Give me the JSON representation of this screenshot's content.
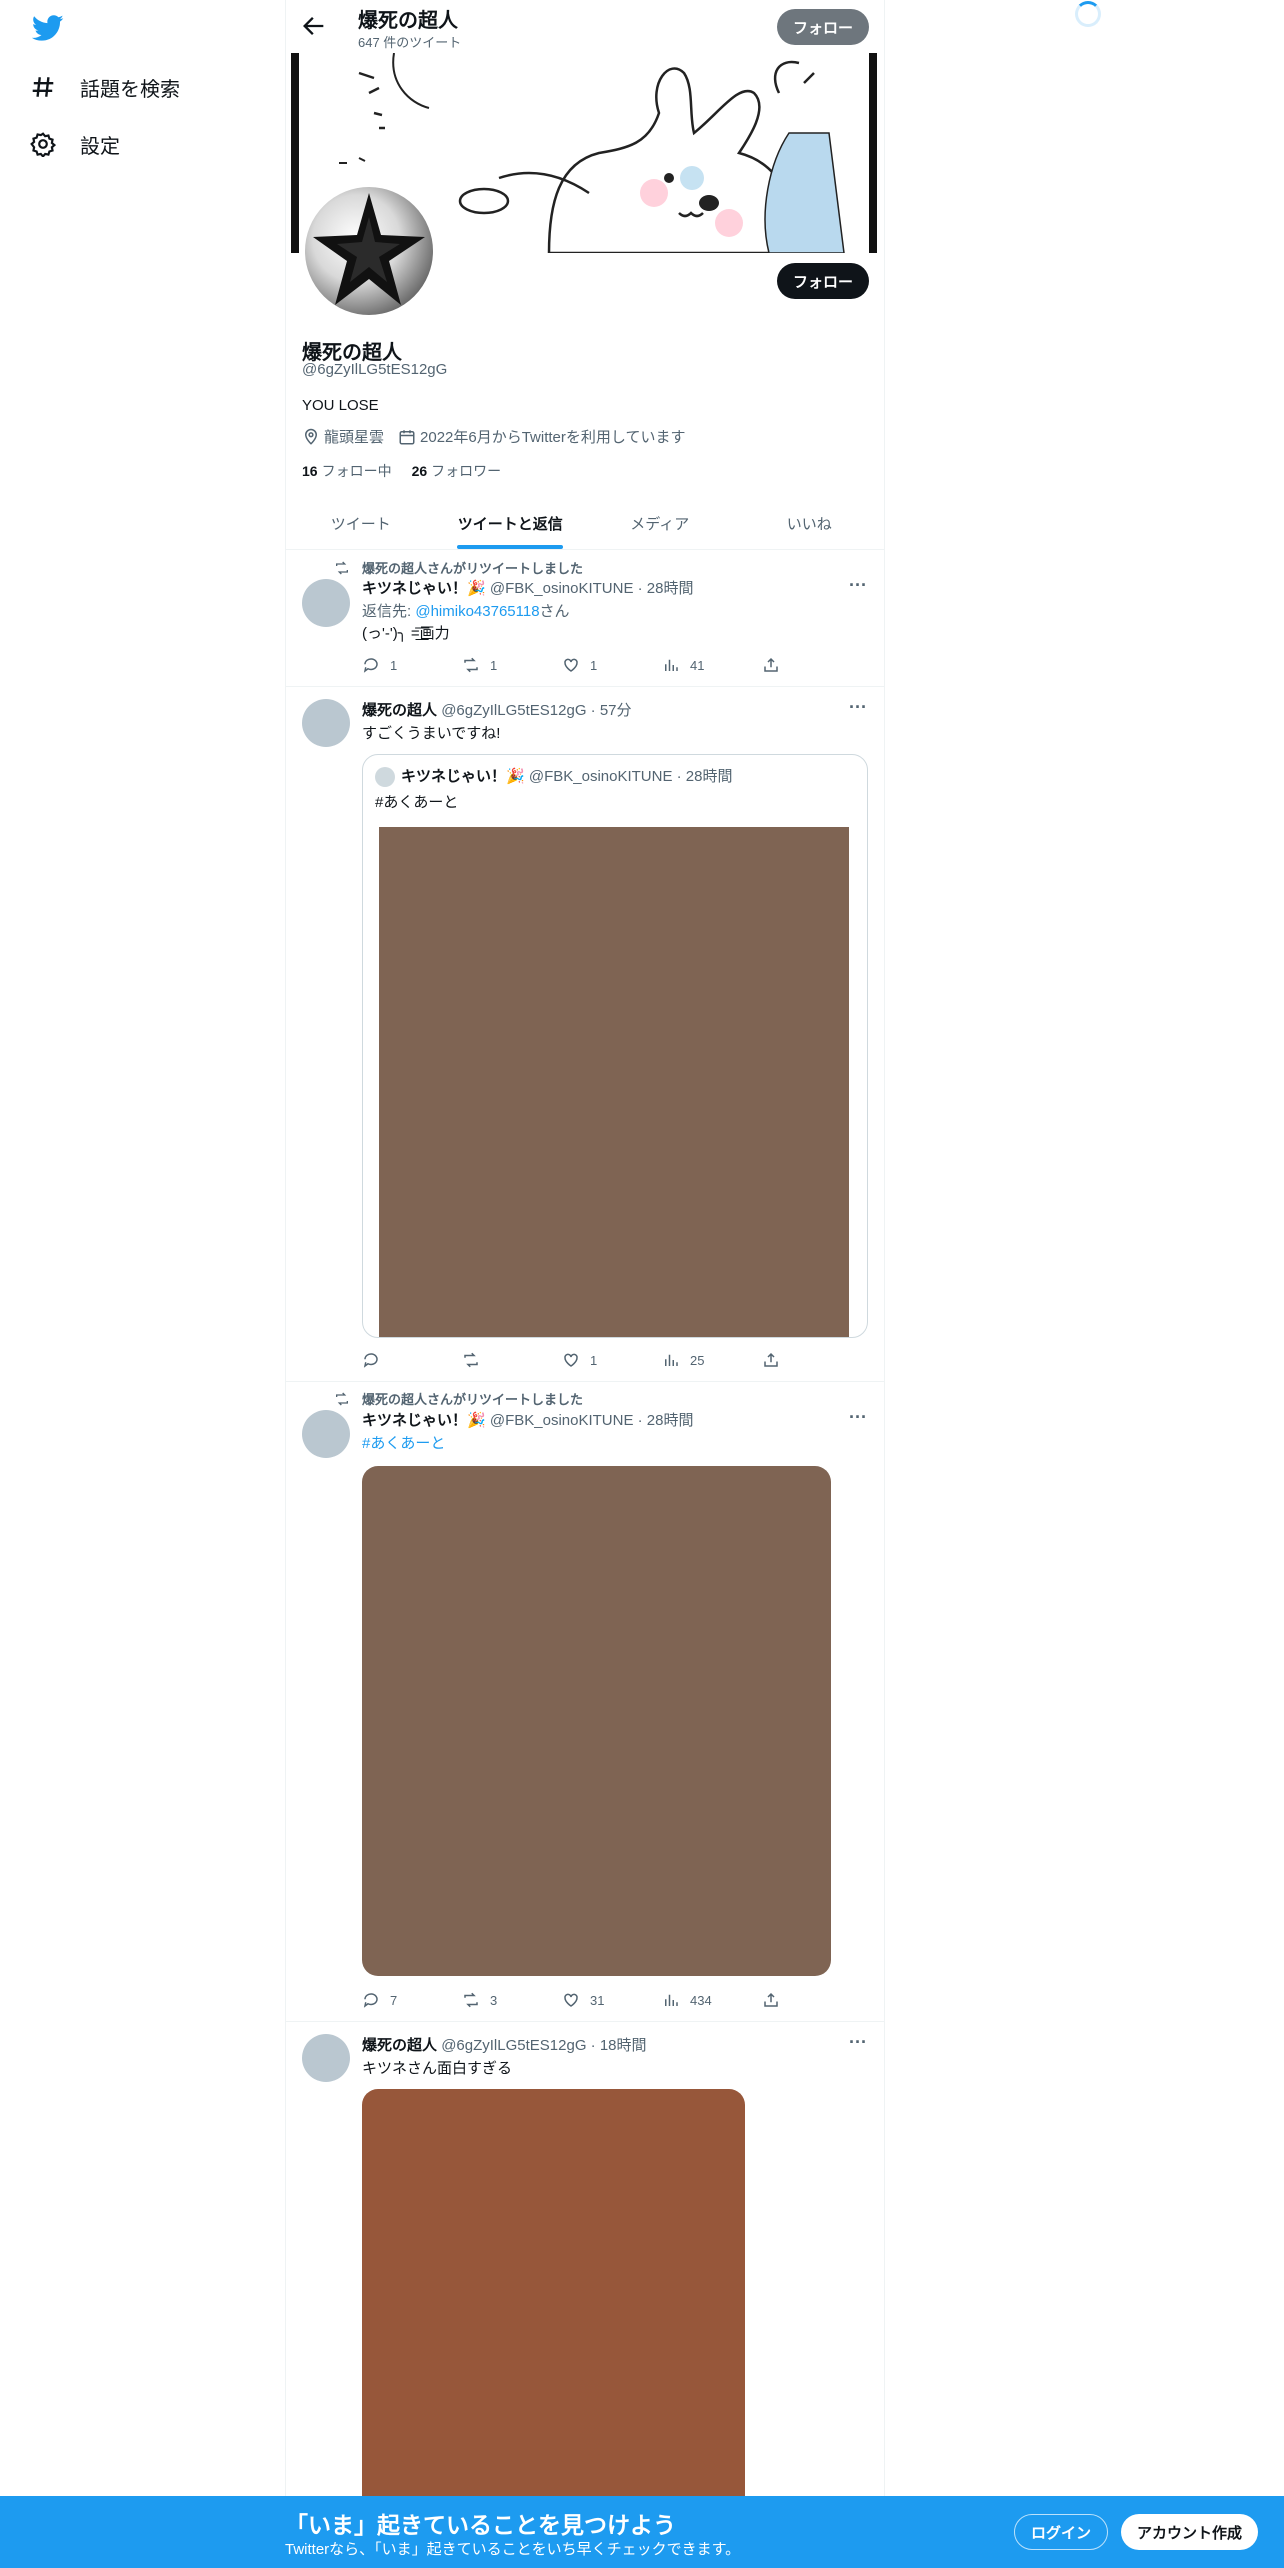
{
  "nav": {
    "logo": "twitter-bird-icon",
    "items": [
      {
        "label": "話題を検索",
        "icon": "hashtag-icon"
      },
      {
        "label": "設定",
        "icon": "gear-icon"
      }
    ]
  },
  "header": {
    "name": "爆死の超人",
    "tweet_count": "647 件のツイート",
    "follow_label": "フォロー"
  },
  "profile": {
    "name": "爆死の超人",
    "handle": "@6gZyIlLG5tES12gG",
    "bio": "YOU LOSE",
    "location": "龍頭星雲",
    "joined": "2022年6月からTwitterを利用しています",
    "following_count": "16",
    "following_label": "フォロー中",
    "followers_count": "26",
    "followers_label": "フォロワー",
    "follow_label": "フォロー"
  },
  "tabs": [
    {
      "label": "ツイート",
      "active": false
    },
    {
      "label": "ツイートと返信",
      "active": true
    },
    {
      "label": "メディア",
      "active": false
    },
    {
      "label": "いいね",
      "active": false
    }
  ],
  "tweets": [
    {
      "retweet_note": "爆死の超人さんがリツイートしました",
      "name": "キツネじゃい！🎉",
      "handle": "@FBK_osinoKITUNE",
      "time": "· 28時間",
      "reply_prefix": "返信先: ",
      "reply_to": "@himiko43765118",
      "reply_suffix": "さん",
      "text": "(っ'-')╮ =͟͟͞͞画力",
      "replies": "1",
      "retweets": "1",
      "likes": "1",
      "views": "41"
    },
    {
      "name": "爆死の超人",
      "handle": "@6gZyIlLG5tES12gG",
      "time": "· 57分",
      "text": "すごくうまいですね!",
      "quote": {
        "name": "キツネじゃい！🎉",
        "handle": "@FBK_osinoKITUNE",
        "time": "· 28時間",
        "text": "#あくあーと"
      },
      "replies": "",
      "retweets": "",
      "likes": "1",
      "views": "25"
    },
    {
      "retweet_note": "爆死の超人さんがリツイートしました",
      "name": "キツネじゃい！🎉",
      "handle": "@FBK_osinoKITUNE",
      "time": "· 28時間",
      "text": "#あくあーと",
      "replies": "7",
      "retweets": "3",
      "likes": "31",
      "views": "434"
    },
    {
      "name": "爆死の超人",
      "handle": "@6gZyIlLG5tES12gG",
      "time": "· 18時間",
      "text": "キツネさん面白すぎる"
    }
  ],
  "colors": {
    "accent": "#1d9bf0",
    "media1": "#7f6453",
    "media2": "#97573a"
  },
  "bottom_bar": {
    "title": "「いま」起きていることを見つけよう",
    "subtitle": "Twitterなら、「いま」起きていることをいち早くチェックできます。",
    "login": "ログイン",
    "signup": "アカウント作成"
  }
}
